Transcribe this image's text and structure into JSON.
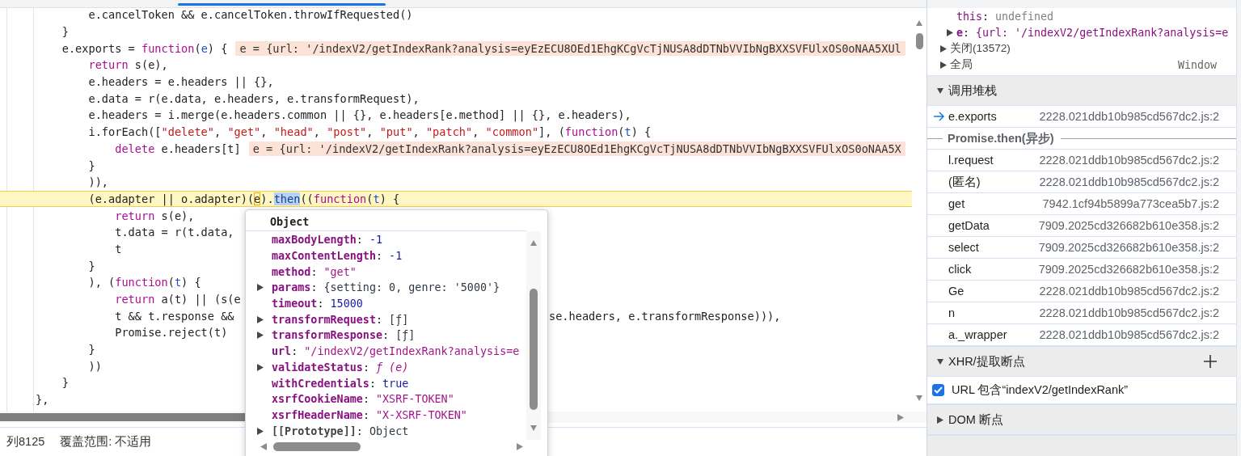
{
  "editor": {
    "lines": [
      {
        "current": false,
        "tokens": [
          {
            "kind": "plain",
            "text": "        e.cancelToken && e.cancelToken.throwIfRequested()"
          }
        ]
      },
      {
        "current": false,
        "tokens": [
          {
            "kind": "plain",
            "text": "    }"
          }
        ]
      },
      {
        "current": false,
        "tokens": [
          {
            "kind": "plain",
            "text": "    e.exports = "
          },
          {
            "kind": "keyword",
            "text": "function"
          },
          {
            "kind": "plain",
            "text": "("
          },
          {
            "kind": "param",
            "text": "e"
          },
          {
            "kind": "plain",
            "text": ") {"
          }
        ],
        "inline_value": "e = {url: '/indexV2/getIndexRank?analysis=eyEzECU8OEd1EhgKCgVcTjNUSA8dDTNbVVIbNgBXXSVFUlxOS0oNAA5XUl"
      },
      {
        "current": false,
        "tokens": [
          {
            "kind": "keyword",
            "text": "        return"
          },
          {
            "kind": "plain",
            "text": " s(e),"
          }
        ]
      },
      {
        "current": false,
        "tokens": [
          {
            "kind": "plain",
            "text": "        e.headers = e.headers || {},"
          }
        ]
      },
      {
        "current": false,
        "tokens": [
          {
            "kind": "plain",
            "text": "        e.data = r(e.data, e.headers, e.transformRequest),"
          }
        ]
      },
      {
        "current": false,
        "tokens": [
          {
            "kind": "plain",
            "text": "        e.headers = i.merge(e.headers.common || {}, e.headers[e.method] || {}, e.headers),"
          }
        ]
      },
      {
        "current": false,
        "tokens": [
          {
            "kind": "plain",
            "text": "        i.forEach(["
          },
          {
            "kind": "string",
            "text": "\"delete\""
          },
          {
            "kind": "plain",
            "text": ", "
          },
          {
            "kind": "string",
            "text": "\"get\""
          },
          {
            "kind": "plain",
            "text": ", "
          },
          {
            "kind": "string",
            "text": "\"head\""
          },
          {
            "kind": "plain",
            "text": ", "
          },
          {
            "kind": "string",
            "text": "\"post\""
          },
          {
            "kind": "plain",
            "text": ", "
          },
          {
            "kind": "string",
            "text": "\"put\""
          },
          {
            "kind": "plain",
            "text": ", "
          },
          {
            "kind": "string",
            "text": "\"patch\""
          },
          {
            "kind": "plain",
            "text": ", "
          },
          {
            "kind": "string",
            "text": "\"common\""
          },
          {
            "kind": "plain",
            "text": "], ("
          },
          {
            "kind": "keyword",
            "text": "function"
          },
          {
            "kind": "plain",
            "text": "("
          },
          {
            "kind": "param",
            "text": "t"
          },
          {
            "kind": "plain",
            "text": ") {"
          }
        ]
      },
      {
        "current": false,
        "tokens": [
          {
            "kind": "keyword",
            "text": "            delete"
          },
          {
            "kind": "plain",
            "text": " e.headers[t]"
          }
        ],
        "inline_value": "e = {url: '/indexV2/getIndexRank?analysis=eyEzECU8OEd1EhgKCgVcTjNUSA8dDTNbVVIbNgBXXSVFUlxOS0oNAA5X"
      },
      {
        "current": false,
        "tokens": [
          {
            "kind": "plain",
            "text": "        }"
          }
        ]
      },
      {
        "current": false,
        "tokens": [
          {
            "kind": "plain",
            "text": "        )),"
          }
        ]
      },
      {
        "current": true,
        "tokens": [
          {
            "kind": "plain",
            "text": "        (e.adapter || o.adapter)("
          },
          {
            "kind": "paused-at",
            "text": "e"
          },
          {
            "kind": "plain",
            "text": ")."
          },
          {
            "kind": "selection",
            "text": "then"
          },
          {
            "kind": "plain",
            "text": "(("
          },
          {
            "kind": "keyword",
            "text": "function"
          },
          {
            "kind": "plain",
            "text": "("
          },
          {
            "kind": "param",
            "text": "t"
          },
          {
            "kind": "plain",
            "text": ") {"
          }
        ]
      },
      {
        "current": false,
        "tokens": [
          {
            "kind": "keyword",
            "text": "            return"
          },
          {
            "kind": "plain",
            "text": " s(e),"
          }
        ]
      },
      {
        "current": false,
        "tokens": [
          {
            "kind": "plain",
            "text": "            t.data = r(t.data,"
          }
        ]
      },
      {
        "current": false,
        "tokens": [
          {
            "kind": "plain",
            "text": "            t"
          }
        ]
      },
      {
        "current": false,
        "tokens": [
          {
            "kind": "plain",
            "text": "        }"
          }
        ]
      },
      {
        "current": false,
        "tokens": [
          {
            "kind": "plain",
            "text": "        ), ("
          },
          {
            "kind": "keyword",
            "text": "function"
          },
          {
            "kind": "plain",
            "text": "("
          },
          {
            "kind": "param",
            "text": "t"
          },
          {
            "kind": "plain",
            "text": ") {"
          }
        ]
      },
      {
        "current": false,
        "tokens": [
          {
            "kind": "keyword",
            "text": "            return"
          },
          {
            "kind": "plain",
            "text": " a(t) || (s(e"
          }
        ]
      },
      {
        "current": false,
        "tokens": [
          {
            "kind": "plain",
            "text": "            t && t.response &&"
          }
        ],
        "tail": "se.headers, e.transformResponse))),"
      },
      {
        "current": false,
        "tokens": [
          {
            "kind": "plain",
            "text": "            Promise.reject(t)"
          }
        ]
      },
      {
        "current": false,
        "tokens": [
          {
            "kind": "plain",
            "text": "        }"
          }
        ]
      },
      {
        "current": false,
        "tokens": [
          {
            "kind": "plain",
            "text": "        ))"
          }
        ]
      },
      {
        "current": false,
        "tokens": [
          {
            "kind": "plain",
            "text": "    }"
          }
        ]
      },
      {
        "current": false,
        "tokens": [
          {
            "kind": "plain",
            "text": "},"
          }
        ]
      }
    ],
    "popover": {
      "title": "Object",
      "rows": [
        {
          "key": "maxBodyLength",
          "separator": ":",
          "value": "-1",
          "kind": "number"
        },
        {
          "key": "maxContentLength",
          "separator": ":",
          "value": "-1",
          "kind": "number"
        },
        {
          "key": "method",
          "separator": ":",
          "value": "\"get\"",
          "kind": "string"
        },
        {
          "key": "params",
          "separator": ":",
          "value": "{setting: 0, genre: '5000'}",
          "kind": "object",
          "expanded": false
        },
        {
          "key": "timeout",
          "separator": ":",
          "value": "15000",
          "kind": "number"
        },
        {
          "key": "transformRequest",
          "separator": ":",
          "value": "[ƒ]",
          "kind": "object",
          "expanded": false
        },
        {
          "key": "transformResponse",
          "separator": ":",
          "value": "[ƒ]",
          "kind": "object",
          "expanded": false
        },
        {
          "key": "url",
          "separator": ":",
          "value": "\"/indexV2/getIndexRank?analysis=e",
          "kind": "string"
        },
        {
          "key": "validateStatus",
          "separator": ":",
          "value": "ƒ (e)",
          "kind": "function",
          "expanded": false
        },
        {
          "key": "withCredentials",
          "separator": ":",
          "value": "true",
          "kind": "boolean"
        },
        {
          "key": "xsrfCookieName",
          "separator": ":",
          "value": "\"XSRF-TOKEN\"",
          "kind": "string"
        },
        {
          "key": "xsrfHeaderName",
          "separator": ":",
          "value": "\"X-XSRF-TOKEN\"",
          "kind": "string"
        },
        {
          "key": "[[Prototype]]",
          "separator": ":",
          "value": "Object",
          "kind": "internal",
          "expanded": false
        }
      ]
    }
  },
  "status_bar": {
    "cursor": "列8125",
    "coverage": "覆盖范围: 不适用"
  },
  "sidebar": {
    "scope": [
      {
        "kind": "property",
        "key": "this",
        "separator": ":",
        "value": "undefined"
      },
      {
        "kind": "property",
        "key": "e",
        "separator": ":",
        "value": "{url: '/indexV2/getIndexRank?analysis=e",
        "expanded": false
      },
      {
        "kind": "group",
        "label": "关闭(13572)",
        "expanded": false
      },
      {
        "kind": "group",
        "label": "全局",
        "value": "Window",
        "expanded": false
      }
    ],
    "call_stack": {
      "title": "调用堆栈",
      "expanded": true,
      "frames": [
        {
          "kind": "frame",
          "name": "e.exports",
          "location": "2228.021ddb10b985cd567dc2.js:2",
          "selected": true
        },
        {
          "kind": "async",
          "name": "Promise.then(异步)"
        },
        {
          "kind": "frame",
          "name": "l.request",
          "location": "2228.021ddb10b985cd567dc2.js:2",
          "selected": false
        },
        {
          "kind": "frame",
          "name": "(匿名)",
          "location": "2228.021ddb10b985cd567dc2.js:2",
          "selected": false
        },
        {
          "kind": "frame",
          "name": "get",
          "location": "7942.1cf94b5899a773cea5b7.js:2",
          "selected": false
        },
        {
          "kind": "frame",
          "name": "getData",
          "location": "7909.2025cd326682b610e358.js:2",
          "selected": false
        },
        {
          "kind": "frame",
          "name": "select",
          "location": "7909.2025cd326682b610e358.js:2",
          "selected": false
        },
        {
          "kind": "frame",
          "name": "click",
          "location": "7909.2025cd326682b610e358.js:2",
          "selected": false
        },
        {
          "kind": "frame",
          "name": "Ge",
          "location": "2228.021ddb10b985cd567dc2.js:2",
          "selected": false
        },
        {
          "kind": "frame",
          "name": "n",
          "location": "2228.021ddb10b985cd567dc2.js:2",
          "selected": false
        },
        {
          "kind": "frame",
          "name": "a._wrapper",
          "location": "2228.021ddb10b985cd567dc2.js:2",
          "selected": false
        }
      ]
    },
    "xhr_breakpoints": {
      "title": "XHR/提取断点",
      "expanded": true,
      "items": [
        {
          "label": "URL 包含“indexV2/getIndexRank”",
          "checked": true
        }
      ]
    },
    "dom_breakpoints": {
      "title": "DOM 断点",
      "expanded": false
    }
  }
}
